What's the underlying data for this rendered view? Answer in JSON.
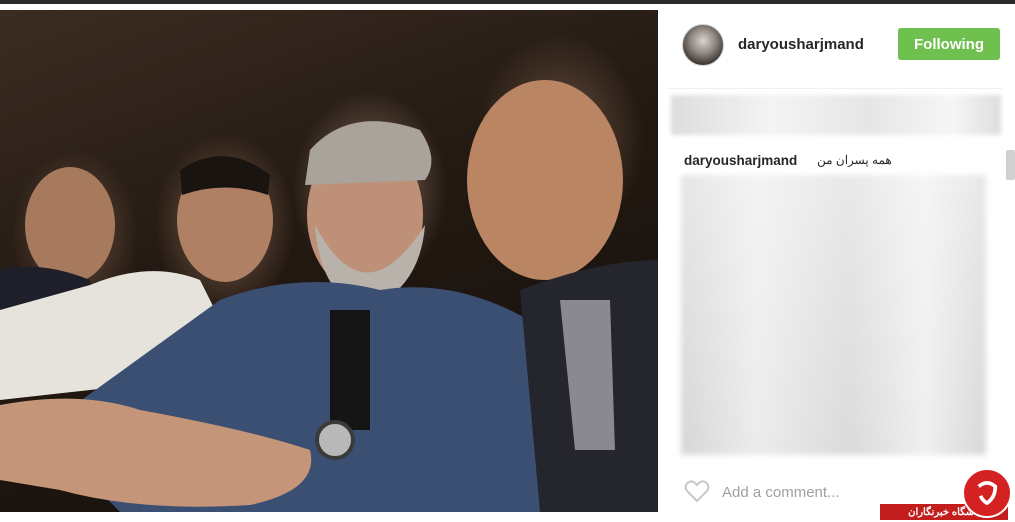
{
  "post": {
    "username": "daryousharjmand",
    "follow_label": "Following",
    "caption_user": "daryousharjmand",
    "caption_text": "همه پسران من",
    "comment_placeholder": "Add a comment..."
  },
  "watermark": {
    "text": "باشگاه خبرنگاران"
  },
  "colors": {
    "follow_button": "#70c050",
    "watermark_red": "#c31e1e"
  },
  "icons": {
    "like": "heart-icon"
  }
}
